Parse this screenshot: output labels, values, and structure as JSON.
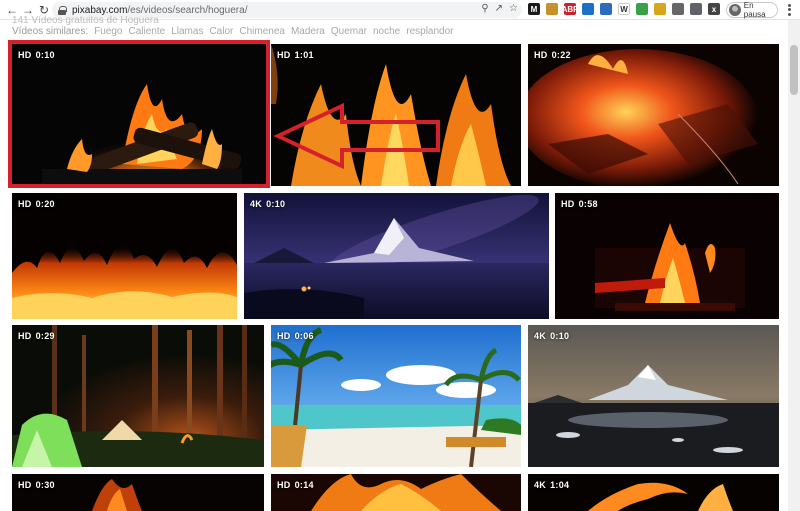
{
  "browser": {
    "url_domain": "pixabay.com",
    "url_path": "/es/videos/search/hoguera/",
    "profile_label": "En pausa",
    "extensions": [
      {
        "icon": "m-ext-icon",
        "color": "#1a1a1a",
        "text": "M"
      },
      {
        "icon": "amber-ext-icon",
        "color": "#c7922c",
        "text": ""
      },
      {
        "icon": "abp-ext-icon",
        "color": "#d0202f",
        "text": "ABP"
      },
      {
        "icon": "blue-ext-icon",
        "color": "#1e6fc6",
        "text": ""
      },
      {
        "icon": "circle-ext-icon",
        "color": "#2a6bbd",
        "text": ""
      },
      {
        "icon": "w-ext-icon",
        "color": "#ffffff",
        "text": "W"
      },
      {
        "icon": "green-ext-icon",
        "color": "#3aa14a",
        "text": ""
      },
      {
        "icon": "yellow-ext-icon",
        "color": "#d6a71c",
        "text": ""
      },
      {
        "icon": "gray-ext-icon",
        "color": "#666666",
        "text": ""
      },
      {
        "icon": "puzzle-ext-icon",
        "color": "#5f6368",
        "text": ""
      },
      {
        "icon": "x-ext-icon",
        "color": "#444444",
        "text": "x"
      }
    ]
  },
  "header": {
    "results_count": "141 Vídeos gratuitos de Hoguera",
    "similar_label": "Vídeos similares:",
    "similar_tags": [
      "Fuego",
      "Caliente",
      "Llamas",
      "Calor",
      "Chimenea",
      "Madera",
      "Quemar",
      "noche",
      "resplandor"
    ]
  },
  "videos": [
    {
      "quality": "HD",
      "duration": "0:10",
      "scene": "campfire-logs"
    },
    {
      "quality": "HD",
      "duration": "1:01",
      "scene": "flames-dark"
    },
    {
      "quality": "HD",
      "duration": "0:22",
      "scene": "embers"
    },
    {
      "quality": "HD",
      "duration": "0:20",
      "scene": "fire-wall"
    },
    {
      "quality": "4K",
      "duration": "0:10",
      "scene": "night-mountain"
    },
    {
      "quality": "HD",
      "duration": "0:58",
      "scene": "fireplace"
    },
    {
      "quality": "HD",
      "duration": "0:29",
      "scene": "camp-forest"
    },
    {
      "quality": "HD",
      "duration": "0:06",
      "scene": "beach"
    },
    {
      "quality": "4K",
      "duration": "0:10",
      "scene": "snow-mountain"
    },
    {
      "quality": "HD",
      "duration": "0:30",
      "scene": "fire-dark"
    },
    {
      "quality": "HD",
      "duration": "0:14",
      "scene": "flames-orange"
    },
    {
      "quality": "4K",
      "duration": "1:04",
      "scene": "flames-curve"
    }
  ],
  "colors": {
    "highlight": "#d4212c",
    "arrow": "#d4212c"
  }
}
